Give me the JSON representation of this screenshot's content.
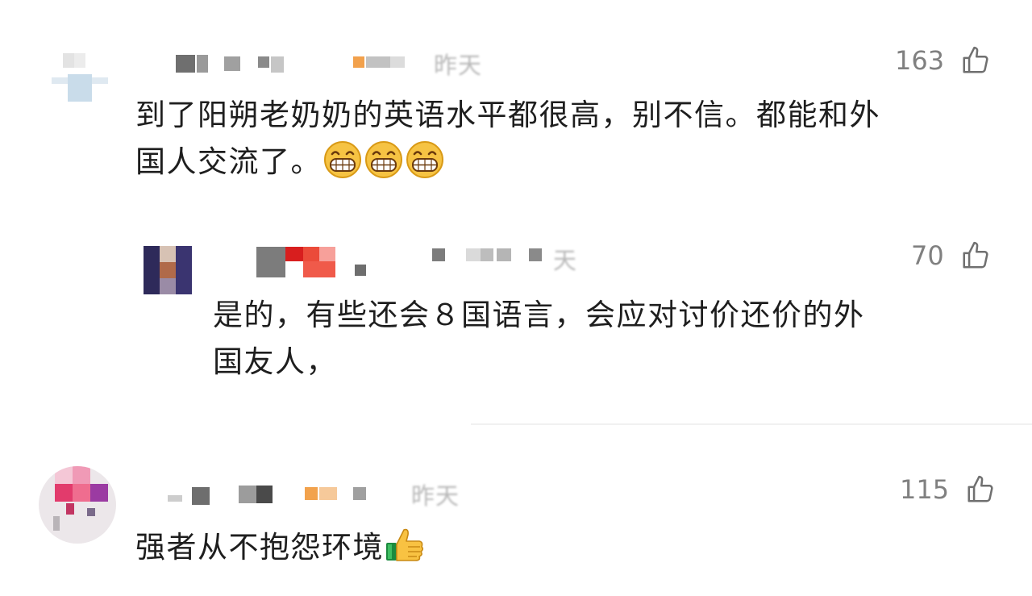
{
  "comments": [
    {
      "time": "昨天",
      "likes": "163",
      "lines": [
        "到了阳朔老奶奶的英语水平都很高，别不信。都能和外",
        "国人交流了。"
      ],
      "emoji": "grinning-face-emoji"
    },
    {
      "time": "天",
      "likes": "70",
      "lines": [
        "是的，有些还会８国语言，会应对讨价还价的外",
        "国友人，"
      ]
    },
    {
      "time": "昨天",
      "likes": "115",
      "lines": [
        "强者从不抱怨环境"
      ],
      "emoji": "thumbs-up-emoji"
    }
  ],
  "colors": {
    "text": "#1e1e1e",
    "meta": "#808080",
    "time": "#b8b8b8",
    "divider": "#f1f1f1"
  },
  "icons": {
    "like": "thumbs-up-outline-icon"
  }
}
